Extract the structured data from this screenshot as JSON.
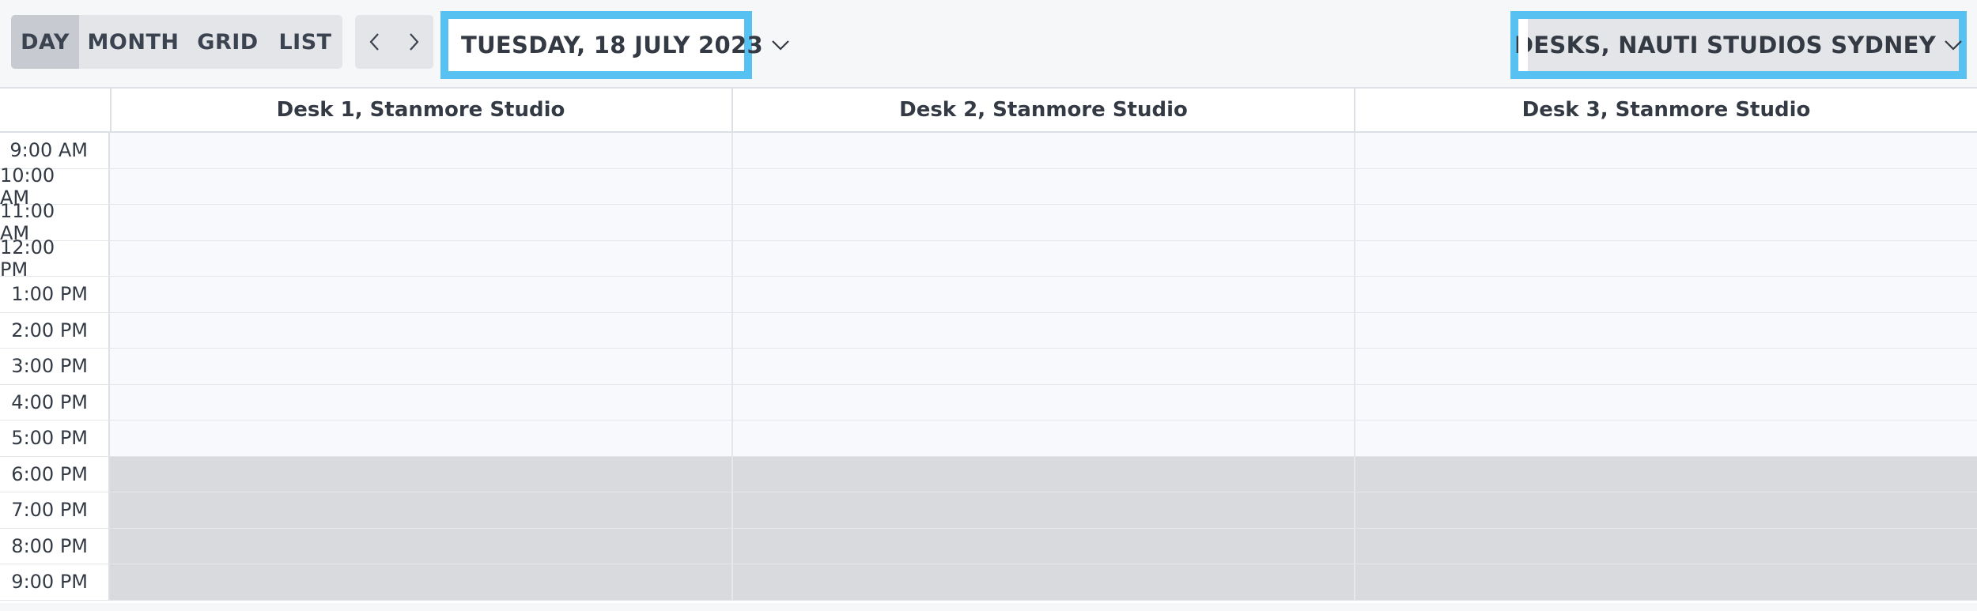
{
  "toolbar": {
    "views": [
      {
        "label": "DAY",
        "active": true
      },
      {
        "label": "MONTH",
        "active": false
      },
      {
        "label": "GRID",
        "active": false
      },
      {
        "label": "LIST",
        "active": false
      }
    ],
    "prev_icon": "chevron-left-icon",
    "next_icon": "chevron-right-icon",
    "date_label": "TUESDAY, 18 JULY 2023",
    "date_dropdown_icon": "chevron-down-icon",
    "location_label": "DESKS, NAUTI STUDIOS SYDNEY",
    "location_dropdown_icon": "chevron-down-icon",
    "highlight_color": "#57c2f2"
  },
  "schedule": {
    "columns": [
      "Desk 1, Stanmore Studio",
      "Desk 2, Stanmore Studio",
      "Desk 3, Stanmore Studio"
    ],
    "times": [
      {
        "label": "9:00 AM",
        "closed": false
      },
      {
        "label": "10:00 AM",
        "closed": false
      },
      {
        "label": "11:00 AM",
        "closed": false
      },
      {
        "label": "12:00 PM",
        "closed": false
      },
      {
        "label": "1:00 PM",
        "closed": false
      },
      {
        "label": "2:00 PM",
        "closed": false
      },
      {
        "label": "3:00 PM",
        "closed": false
      },
      {
        "label": "4:00 PM",
        "closed": false
      },
      {
        "label": "5:00 PM",
        "closed": false
      },
      {
        "label": "6:00 PM",
        "closed": true
      },
      {
        "label": "7:00 PM",
        "closed": true
      },
      {
        "label": "8:00 PM",
        "closed": true
      },
      {
        "label": "9:00 PM",
        "closed": true
      }
    ],
    "open_color": "#f7f9fc",
    "closed_color": "#d8dade"
  }
}
